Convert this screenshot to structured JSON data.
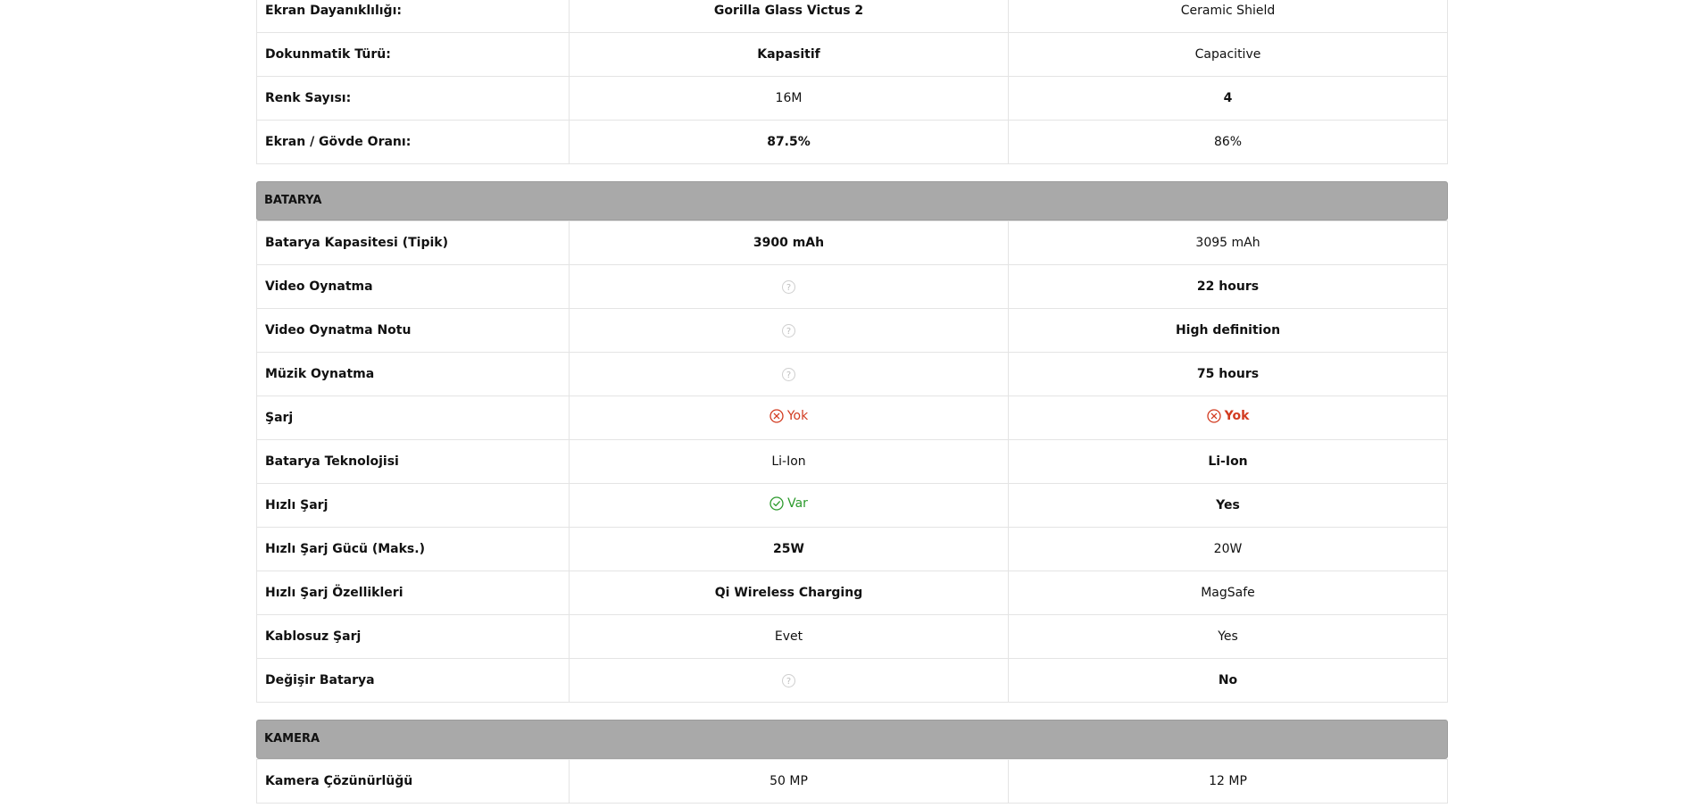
{
  "display_rows": [
    {
      "label": "Ekran Dayanıklılığı:",
      "a": "Gorilla Glass Victus 2",
      "b": "Ceramic Shield",
      "bold": "a"
    },
    {
      "label": "Dokunmatik Türü:",
      "a": "Kapasitif",
      "b": "Capacitive",
      "bold": "a"
    },
    {
      "label": "Renk Sayısı:",
      "a": "16M",
      "b": "4",
      "bold": "b"
    },
    {
      "label": "Ekran / Gövde Oranı:",
      "a": "87.5%",
      "b": "86%",
      "bold": "a"
    }
  ],
  "battery_section": {
    "title": "BATARYA",
    "rows": [
      {
        "label": "Batarya Kapasitesi (Tipik)",
        "a": "3900 mAh",
        "b": "3095 mAh",
        "bold": "a"
      },
      {
        "label": "Video Oynatma",
        "a": "",
        "a_icon": "question-icon",
        "b": "22 hours",
        "bold": "b"
      },
      {
        "label": "Video Oynatma Notu",
        "a": "",
        "a_icon": "question-icon",
        "b": "High definition",
        "bold": "b"
      },
      {
        "label": "Müzik Oynatma",
        "a": "",
        "a_icon": "question-icon",
        "b": "75 hours",
        "bold": "b"
      },
      {
        "label": "Şarj",
        "a": "Yok",
        "a_icon": "x-circle-icon",
        "b": "Yok",
        "b_icon": "x-circle-icon",
        "bold": "b"
      },
      {
        "label": "Batarya Teknolojisi",
        "a": "Li-Ion",
        "b": "Li-Ion",
        "bold": "b"
      },
      {
        "label": "Hızlı Şarj",
        "a": "Var",
        "a_icon": "check-circle-icon",
        "b": "Yes",
        "bold": "b"
      },
      {
        "label": "Hızlı Şarj Gücü (Maks.)",
        "a": "25W",
        "b": "20W",
        "bold": "a"
      },
      {
        "label": "Hızlı Şarj Özellikleri",
        "a": "Qi Wireless Charging",
        "b": "MagSafe",
        "bold": "a"
      },
      {
        "label": "Kablosuz Şarj",
        "a": "Evet",
        "b": "Yes",
        "bold": ""
      },
      {
        "label": "Değişir Batarya",
        "a": "",
        "a_icon": "question-icon",
        "b": "No",
        "bold": "b"
      }
    ]
  },
  "camera_section": {
    "title": "KAMERA",
    "rows": [
      {
        "label": "Kamera Çözünürlüğü",
        "a": "50 MP",
        "b": "12 MP",
        "bold": ""
      }
    ]
  },
  "colors": {
    "section_bg": "#a9a9a9",
    "no_red": "#d23b20",
    "yes_green": "#2c9a2c",
    "border": "#e4e4e4"
  }
}
